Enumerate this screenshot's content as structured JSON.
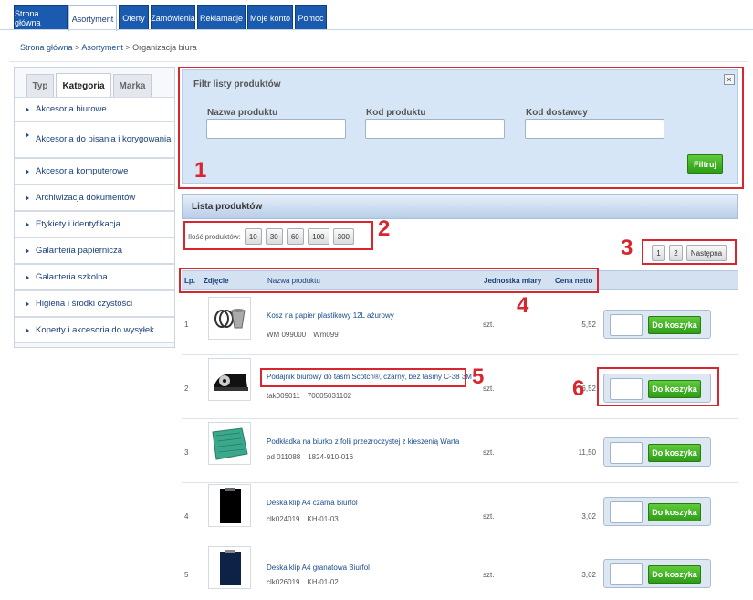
{
  "nav": {
    "tabs": [
      {
        "label": "Strona główna"
      },
      {
        "label": "Asortyment"
      },
      {
        "label": "Oferty"
      },
      {
        "label": "Zamówienia"
      },
      {
        "label": "Reklamacje"
      },
      {
        "label": "Moje konto"
      },
      {
        "label": "Pomoc"
      }
    ],
    "active": "Asortyment"
  },
  "breadcrumb": {
    "items": [
      "Strona główna",
      "Asortyment",
      "Organizacja biura"
    ],
    "separator": ">"
  },
  "sidebar": {
    "tabs": [
      "Typ",
      "Kategoria",
      "Marka"
    ],
    "active_tab": "Kategoria",
    "categories": [
      "Akcesoria biurowe",
      "Akcesoria do pisania i korygowania",
      "Akcesoria komputerowe",
      "Archiwizacja dokumentów",
      "Etykiety i identyfikacja",
      "Galanteria papiernicza",
      "Galanteria szkolna",
      "Higiena i środki czystości",
      "Koperty i akcesoria do wysyłek"
    ]
  },
  "filter": {
    "title": "Filtr listy produktów",
    "fields": [
      {
        "label": "Nazwa produktu",
        "value": ""
      },
      {
        "label": "Kod produktu",
        "value": ""
      },
      {
        "label": "Kod dostawcy",
        "value": ""
      }
    ],
    "close_label": "×",
    "button_label": "Filtruj"
  },
  "list": {
    "title": "Lista produktów",
    "qty_label": "Ilość produktów:",
    "qty_options": [
      "10",
      "30",
      "60",
      "100",
      "300"
    ],
    "pager": [
      "1",
      "2",
      "Następna"
    ],
    "columns": {
      "lp": "Lp.",
      "photo": "Zdjęcie",
      "name": "Nazwa produktu",
      "unit": "Jednostka miary",
      "price": "Cena netto"
    },
    "cart_button": "Do koszyka",
    "products": [
      {
        "lp": "1",
        "name": "Kosz na papier plastikowy 12L ażurowy",
        "code": "WM 099000",
        "supplier": "Wm099",
        "unit": "szt.",
        "price": "5,52",
        "icon": "waste-basket-icon"
      },
      {
        "lp": "2",
        "name": "Podajnik biurowy do taśm Scotch®, czarny, bez taśmy C-38 3M",
        "code": "tak009011",
        "supplier": "70005031102",
        "unit": "szt.",
        "price": "6,52",
        "icon": "tape-dispenser-icon"
      },
      {
        "lp": "3",
        "name": "Podkładka na biurko z folii przezroczystej z kieszenią Warta",
        "code": "pd 011088",
        "supplier": "1824-910-016",
        "unit": "szt.",
        "price": "11,50",
        "icon": "desk-pad-icon"
      },
      {
        "lp": "4",
        "name": "Deska klip A4 czarna Biurfol",
        "code": "clk024019",
        "supplier": "KH-01-03",
        "unit": "szt.",
        "price": "3,02",
        "icon": "clipboard-black-icon"
      },
      {
        "lp": "5",
        "name": "Deska klip A4 granatowa Biurfol",
        "code": "clk026019",
        "supplier": "KH-01-02",
        "unit": "szt.",
        "price": "3,02",
        "icon": "clipboard-navy-icon"
      }
    ]
  },
  "annotations": [
    "1",
    "2",
    "3",
    "4",
    "5",
    "6"
  ],
  "colors": {
    "nav_blue": "#1a5bb0",
    "annotation_red": "#d8262e",
    "button_green": "#2e9d17",
    "filter_bg": "#d7e6f6"
  }
}
